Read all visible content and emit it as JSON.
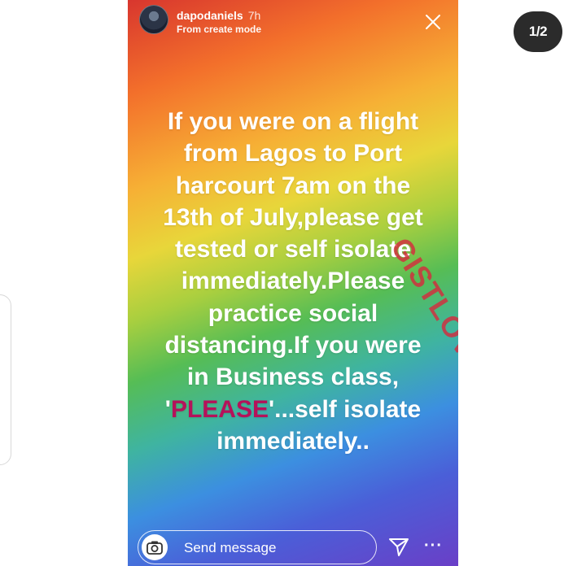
{
  "pagination": "1/2",
  "story": {
    "username": "dapodaniels",
    "time_ago": "7h",
    "subtitle": "From create mode",
    "text_lines": [
      "If you were on a flight",
      "from Lagos to Port",
      "harcourt 7am on the",
      "13th of July,please get",
      "tested or self isolate",
      "immediately.Please",
      "practice social",
      "distancing.If you were",
      "in Business class,"
    ],
    "text_please_prefix": "'",
    "text_please": "PLEASE",
    "text_please_suffix": "'...self isolate",
    "text_last_line": "immediately..",
    "watermark": "GISTLOVERS",
    "footer": {
      "send_placeholder": "Send message",
      "camera_icon": "camera-icon",
      "send_icon": "paper-plane-icon",
      "more_icon": "more-icon"
    }
  },
  "colors": {
    "please_accent": "#b5125a",
    "badge_bg": "#2b2b2b"
  }
}
